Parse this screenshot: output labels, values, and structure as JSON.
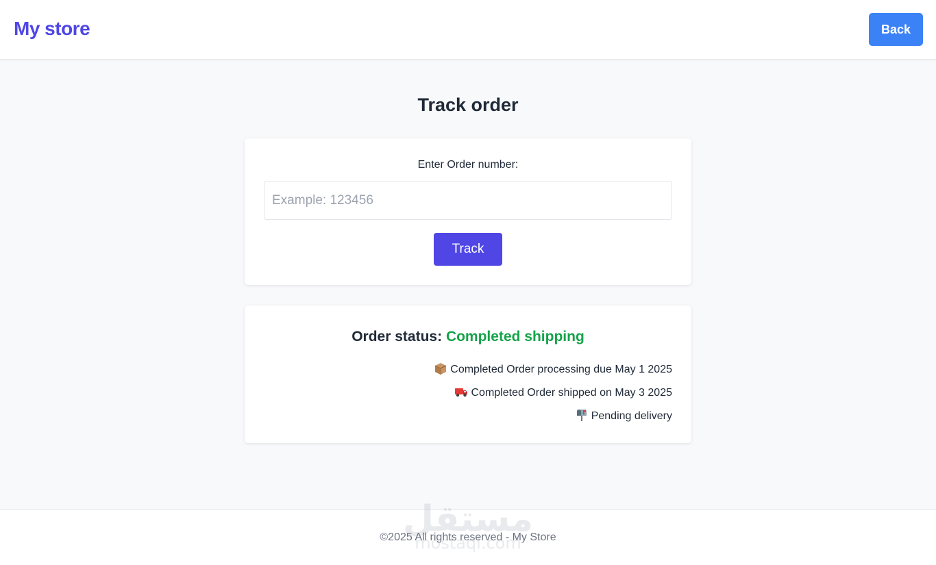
{
  "header": {
    "brand": "My store",
    "back_label": "Back"
  },
  "main": {
    "title": "Track order"
  },
  "track_form": {
    "label": "Enter Order number:",
    "placeholder": "Example: 123456",
    "button_label": "Track"
  },
  "status": {
    "label": "Order status:",
    "value": "Completed shipping",
    "steps": [
      {
        "icon": "package-icon",
        "text": "Completed Order processing due May 1 2025"
      },
      {
        "icon": "truck-icon",
        "text": "Completed Order shipped on May 3 2025"
      },
      {
        "icon": "mailbox-icon",
        "text": "Pending delivery"
      }
    ]
  },
  "footer": {
    "text": "©2025 All rights reserved - My Store"
  },
  "watermark": {
    "arabic": "مستقل",
    "latin": "mostaql.com"
  },
  "colors": {
    "brand": "#4f46e5",
    "back_button": "#3b82f6",
    "track_button": "#4f46e5",
    "status_value": "#16a34a"
  }
}
